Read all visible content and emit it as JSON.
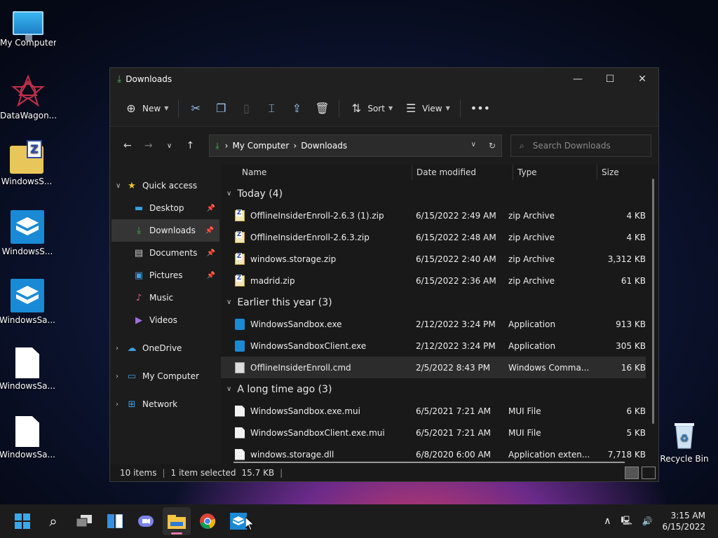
{
  "desktop": {
    "icons": [
      {
        "label": "My Computer",
        "icon": "monitor-icon"
      },
      {
        "label": "DataWagon...",
        "icon": "star-logo-icon"
      },
      {
        "label": "WindowsS...",
        "icon": "zip-folder-icon"
      },
      {
        "label": "WindowsS...",
        "icon": "sandbox-icon"
      },
      {
        "label": "WindowsSa...",
        "icon": "sandbox-icon"
      },
      {
        "label": "WindowsSa...",
        "icon": "document-icon"
      },
      {
        "label": "WindowsSa...",
        "icon": "document-icon"
      },
      {
        "label": "Recycle Bin",
        "icon": "recycle-bin-icon"
      }
    ]
  },
  "window": {
    "title": "Downloads",
    "toolbar": {
      "new_label": "New",
      "sort_label": "Sort",
      "view_label": "View"
    },
    "address": {
      "crumbs": [
        "My Computer",
        "Downloads"
      ]
    },
    "search": {
      "placeholder": "Search Downloads"
    },
    "nav": {
      "quick_access": "Quick access",
      "items": [
        "Desktop",
        "Downloads",
        "Documents",
        "Pictures",
        "Music",
        "Videos"
      ],
      "onedrive": "OneDrive",
      "my_computer": "My Computer",
      "network": "Network"
    },
    "columns": {
      "name": "Name",
      "date": "Date modified",
      "type": "Type",
      "size": "Size"
    },
    "groups": [
      {
        "label": "Today (4)",
        "rows": [
          {
            "name": "OfflineInsiderEnroll-2.6.3 (1).zip",
            "date": "6/15/2022 2:49 AM",
            "type": "zip Archive",
            "size": "4 KB"
          },
          {
            "name": "OfflineInsiderEnroll-2.6.3.zip",
            "date": "6/15/2022 2:48 AM",
            "type": "zip Archive",
            "size": "4 KB"
          },
          {
            "name": "windows.storage.zip",
            "date": "6/15/2022 2:40 AM",
            "type": "zip Archive",
            "size": "3,312 KB"
          },
          {
            "name": "madrid.zip",
            "date": "6/15/2022 2:36 AM",
            "type": "zip Archive",
            "size": "61 KB"
          }
        ]
      },
      {
        "label": "Earlier this year (3)",
        "rows": [
          {
            "name": "WindowsSandbox.exe",
            "date": "2/12/2022 3:24 PM",
            "type": "Application",
            "size": "913 KB"
          },
          {
            "name": "WindowsSandboxClient.exe",
            "date": "2/12/2022 3:24 PM",
            "type": "Application",
            "size": "305 KB"
          },
          {
            "name": "OfflineInsiderEnroll.cmd",
            "date": "2/5/2022 8:43 PM",
            "type": "Windows Comma...",
            "size": "16 KB"
          }
        ]
      },
      {
        "label": "A long time ago (3)",
        "rows": [
          {
            "name": "WindowsSandbox.exe.mui",
            "date": "6/5/2021 7:21 AM",
            "type": "MUI File",
            "size": "6 KB"
          },
          {
            "name": "WindowsSandboxClient.exe.mui",
            "date": "6/5/2021 7:21 AM",
            "type": "MUI File",
            "size": "5 KB"
          },
          {
            "name": "windows.storage.dll",
            "date": "6/8/2020 6:00 AM",
            "type": "Application exten...",
            "size": "7,718 KB"
          }
        ]
      }
    ],
    "status": {
      "count": "10 items",
      "selected": "1 item selected",
      "size": "15.7 KB"
    }
  },
  "taskbar": {
    "time": "3:15 AM",
    "date": "6/15/2022"
  }
}
